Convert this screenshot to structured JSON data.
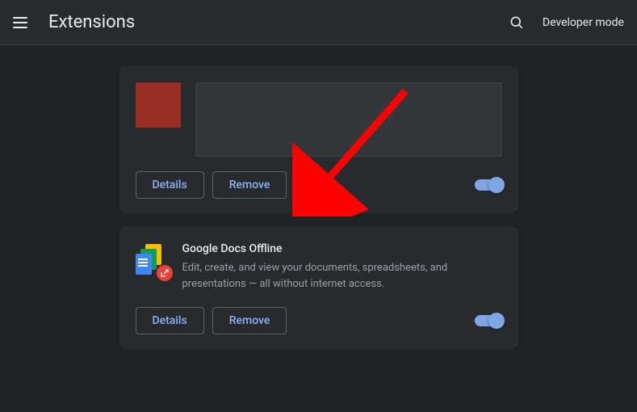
{
  "header": {
    "title": "Extensions",
    "dev_mode_label": "Developer mode"
  },
  "cards": [
    {
      "details_label": "Details",
      "remove_label": "Remove",
      "enabled": true
    },
    {
      "name": "Google Docs Offline",
      "description": "Edit, create, and view your documents, spreadsheets, and presentations — all without internet access.",
      "details_label": "Details",
      "remove_label": "Remove",
      "enabled": true
    }
  ]
}
